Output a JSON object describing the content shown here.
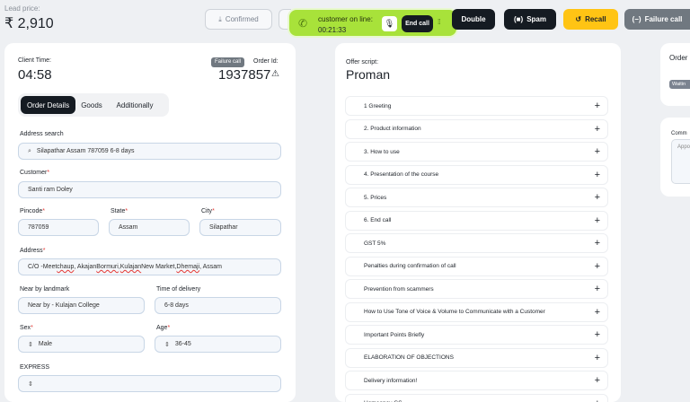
{
  "header": {
    "lead_label": "Lead price:",
    "lead_price": "₹ 2,910",
    "confirmed_label": "Confirmed",
    "double_label": "Double",
    "spam_label": "Spam",
    "recall_label": "Recall",
    "failure_label": "Failure call"
  },
  "call": {
    "status": "customer on line:",
    "timer": "00:21:33",
    "end_label": "End call"
  },
  "order": {
    "client_time_label": "Client Time:",
    "client_time": "04:58",
    "status_badge": "Failure call",
    "order_id_label": "Order Id:",
    "order_id": "1937857",
    "tabs": [
      "Order Details",
      "Goods",
      "Additionally"
    ],
    "address_search_label": "Address search",
    "address_search_value": "Silapathar Assam 787059 6-8 days",
    "customer_label": "Customer",
    "customer_value": "Santi ram Doley",
    "pincode_label": "Pincode",
    "pincode_value": "787059",
    "state_label": "State",
    "state_value": "Assam",
    "city_label": "City",
    "city_value": "Silapathar",
    "address_label": "Address",
    "address_parts": [
      "C/O -Meet ",
      "chaup",
      " , Akajan ",
      "Bormuri",
      " , ",
      "Kulajan",
      " New Market, ",
      "Dhemaji",
      " , Assam"
    ],
    "landmark_label": "Near by landmark",
    "landmark_value": "Near by - Kulajan College",
    "delivery_label": "Time of delivery",
    "delivery_value": "6-8 days",
    "sex_label": "Sex",
    "sex_value": "Male",
    "age_label": "Age",
    "age_value": "36-45",
    "express_label": "EXPRESS"
  },
  "script": {
    "label": "Offer script:",
    "title": "Proman",
    "items": [
      "1 Greeting",
      "2. Product information",
      "3. How to use",
      "4. Presentation of the course",
      "5. Prices",
      "6. End call",
      "GST 5%",
      "Penalties during confirmation of call",
      "Prevention from scammers",
      "How to Use Tone of Voice & Volume to Communicate with a Customer",
      "Important Points Briefly",
      "ELABORATION OF OBJECTIONS",
      "Delivery information!",
      "Homeopay GS"
    ]
  },
  "side": {
    "order_title": "Order",
    "status_badge": "Waitin",
    "comment_label": "Comm",
    "comment_placeholder": "Appo"
  },
  "colors": {
    "accent_green": "#a8e23a",
    "recall_yellow": "#ffc414",
    "dark": "#151b22",
    "failure_gray": "#707880"
  }
}
